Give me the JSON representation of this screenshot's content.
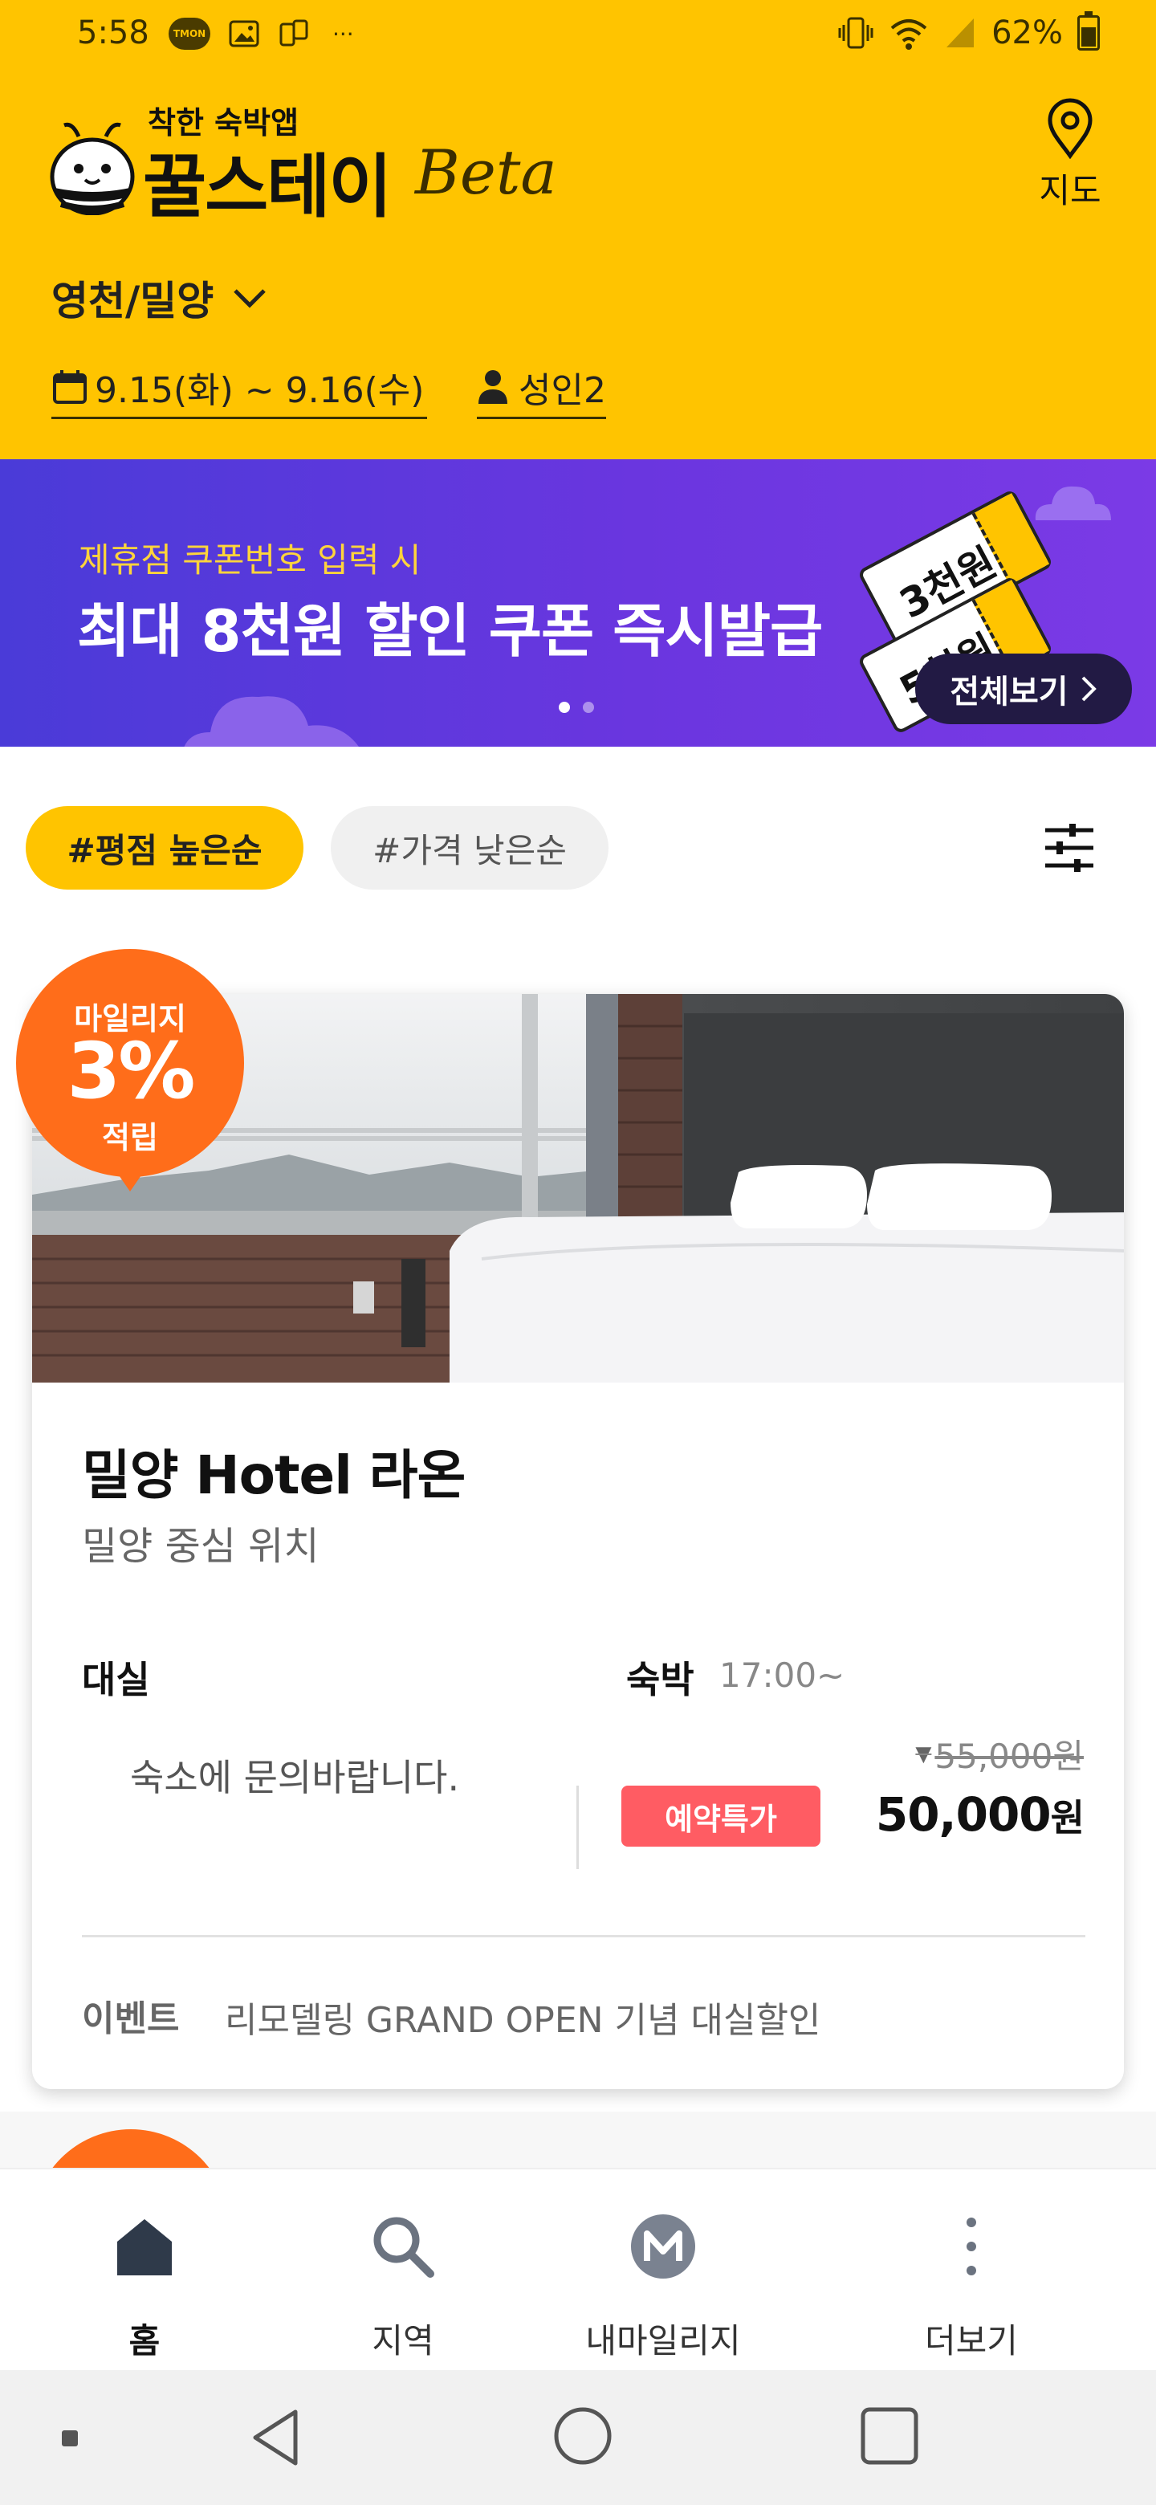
{
  "status_bar": {
    "time": "5:58",
    "tmon": "TMON",
    "extra": "···",
    "battery": "62%"
  },
  "header": {
    "logo_tagline": "착한 숙박앱",
    "logo_name": "꿀스테이",
    "logo_beta": "Beta",
    "map_label": "지도",
    "region": "영천/밀양",
    "dates": "9.15(화) ~ 9.16(수)",
    "guests": "성인2"
  },
  "banner": {
    "subtitle": "제휴점 쿠폰번호 입력 시",
    "title": "최대 8천원 할인 쿠폰  즉시발급",
    "ticket_1": "3천원",
    "ticket_2": "5천원",
    "see_all": "전체보기",
    "slide_count": 2,
    "active_slide": 1
  },
  "sort": {
    "rating": "#평점 높은순",
    "price": "#가격 낮은순"
  },
  "listing": {
    "mileage_top": "마일리지",
    "mileage_pct": "3%",
    "mileage_bottom": "적립",
    "name": "밀양 Hotel 라온",
    "subtitle": "밀양 중심 위치",
    "day_label": "대실",
    "day_text": "숙소에 문의바랍니다.",
    "night_label": "숙박",
    "night_time": "17:00~",
    "promo": "예약특가",
    "original_price": "55,000원",
    "price_number": "50,000",
    "price_unit": "원",
    "event_label": "이벤트",
    "event_text": "리모델링 GRAND OPEN 기념 대실할인"
  },
  "bottom_nav": {
    "home": "홈",
    "region": "지역",
    "mileage": "내마일리지",
    "more": "더보기"
  },
  "colors": {
    "brand_yellow": "#FFC400",
    "banner_purple": "#5a3ae0",
    "mileage_orange": "#FF6D1A",
    "promo_red": "#FF5C63"
  }
}
